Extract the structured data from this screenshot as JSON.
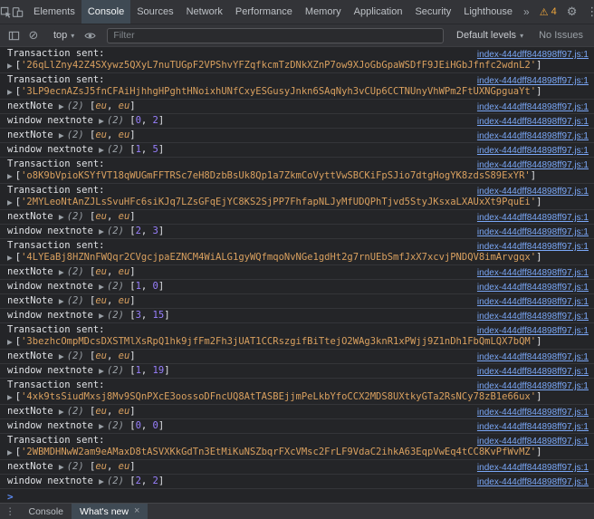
{
  "top_bar": {
    "tabs": [
      {
        "label": "Elements",
        "selected": false
      },
      {
        "label": "Console",
        "selected": true
      },
      {
        "label": "Sources",
        "selected": false
      },
      {
        "label": "Network",
        "selected": false
      },
      {
        "label": "Performance",
        "selected": false
      },
      {
        "label": "Memory",
        "selected": false
      },
      {
        "label": "Application",
        "selected": false
      },
      {
        "label": "Security",
        "selected": false
      },
      {
        "label": "Lighthouse",
        "selected": false
      }
    ],
    "warning_count": "4"
  },
  "toolbar": {
    "context_selector": "top",
    "filter_placeholder": "Filter",
    "levels_selector": "Default levels",
    "issues_label": "No Issues"
  },
  "console": {
    "source_link": "index-444dff844898ff97.js:1",
    "entries": [
      {
        "type": "tx",
        "label": "Transaction sent:",
        "string": "'26qLlZny42Z4SXywz5QXyL7nuTUGpF2VPShvYFZqfkcmTzDNkXZnP7ow9XJoGbGpaWSDfF9JEiHGbJfnfc2wdnL2'"
      },
      {
        "type": "tx",
        "label": "Transaction sent:",
        "string": "'3LP9ecnAZsJ5fnCFAiHjhhgHPghtHNoixhUNfCxyESGusyJnkn6SAqNyh3vCUp6CCTNUnyVhWPm2FtUXNGpguaYt'"
      },
      {
        "type": "arr",
        "label": "nextNote",
        "kind": "obj",
        "items": [
          "eu",
          "eu"
        ]
      },
      {
        "type": "arr",
        "label": "window nextnote",
        "kind": "num",
        "items": [
          "0",
          "2"
        ]
      },
      {
        "type": "arr",
        "label": "nextNote",
        "kind": "obj",
        "items": [
          "eu",
          "eu"
        ]
      },
      {
        "type": "arr",
        "label": "window nextnote",
        "kind": "num",
        "items": [
          "1",
          "5"
        ]
      },
      {
        "type": "tx",
        "label": "Transaction sent:",
        "string": "'o8K9bVpioKSYfVT18qWUGmFFTRSc7eH8DzbBsUk8Qp1a7ZkmCoVyttVwSBCKiFpSJio7dtgHogYK8zdsS89ExYR'"
      },
      {
        "type": "tx",
        "label": "Transaction sent:",
        "string": "'2MYLeoNtAnZJLsSvuHFc6siKJq7LZsGFqEjYC8KS2SjPP7FhfapNLJyMfUDQPhTjvd5StyJKsxaLXAUxXt9PquEi'"
      },
      {
        "type": "arr",
        "label": "nextNote",
        "kind": "obj",
        "items": [
          "eu",
          "eu"
        ]
      },
      {
        "type": "arr",
        "label": "window nextnote",
        "kind": "num",
        "items": [
          "2",
          "3"
        ]
      },
      {
        "type": "tx",
        "label": "Transaction sent:",
        "string": "'4LYEaBj8HZNnFWQqr2CVgcjpaEZNCM4WiALG1gyWQfmqoNvNGe1gdHt2g7rnUEbSmfJxX7xcvjPNDQV8imArvgqx'"
      },
      {
        "type": "arr",
        "label": "nextNote",
        "kind": "obj",
        "items": [
          "eu",
          "eu"
        ]
      },
      {
        "type": "arr",
        "label": "window nextnote",
        "kind": "num",
        "items": [
          "1",
          "0"
        ]
      },
      {
        "type": "arr",
        "label": "nextNote",
        "kind": "obj",
        "items": [
          "eu",
          "eu"
        ]
      },
      {
        "type": "arr",
        "label": "window nextnote",
        "kind": "num",
        "items": [
          "3",
          "15"
        ]
      },
      {
        "type": "tx",
        "label": "Transaction sent:",
        "string": "'3bezhcOmpMDcsDXSTMlXsRpQ1hk9jfFm2Fh3jUAT1CCRszgifBiTtejO2WAg3knR1xPWjj9Z1nDh1FbQmLQX7bQM'"
      },
      {
        "type": "arr",
        "label": "nextNote",
        "kind": "obj",
        "items": [
          "eu",
          "eu"
        ]
      },
      {
        "type": "arr",
        "label": "window nextnote",
        "kind": "num",
        "items": [
          "1",
          "19"
        ]
      },
      {
        "type": "tx",
        "label": "Transaction sent:",
        "string": "'4xk9tsSiudMxsj8Mv9SQnPXcE3oossoDFncUQ8AtTASBEjjmPeLkbYfoCCX2MDS8UXtkyGTa2RsNCy78zB1e66ux'"
      },
      {
        "type": "arr",
        "label": "nextNote",
        "kind": "obj",
        "items": [
          "eu",
          "eu"
        ]
      },
      {
        "type": "arr",
        "label": "window nextnote",
        "kind": "num",
        "items": [
          "0",
          "0"
        ]
      },
      {
        "type": "tx",
        "label": "Transaction sent:",
        "string": "'2WBMDHNwW2am9eAMaxD8tASVXKkGdTn3EtMiKuNSZbqrFXcVMsc2FrLF9VdaC2ihkA63EqpVwEq4tCC8KvPfWvMZ'"
      },
      {
        "type": "arr",
        "label": "nextNote",
        "kind": "obj",
        "items": [
          "eu",
          "eu"
        ]
      },
      {
        "type": "arr",
        "label": "window nextnote",
        "kind": "num",
        "items": [
          "2",
          "2"
        ]
      }
    ]
  },
  "drawer": {
    "tabs": [
      {
        "label": "Console",
        "selected": false,
        "closable": false
      },
      {
        "label": "What's new",
        "selected": true,
        "closable": true
      }
    ]
  },
  "icons": {
    "expand_arrow": "▶",
    "dropdown_arrow": "▾",
    "more_tabs": "»",
    "warning": "⚠",
    "gear": "⚙",
    "kebab": "⋮",
    "clear": "⊘",
    "close": "×",
    "prompt_chevron": ">"
  },
  "colors": {
    "link": "#7aa7f7",
    "string": "#d9a05f",
    "number": "#9980ff",
    "warning": "#f0a73b",
    "selected_tab_bg": "#3f4a54",
    "panel_bg": "#242528",
    "bar_bg": "#333438"
  }
}
